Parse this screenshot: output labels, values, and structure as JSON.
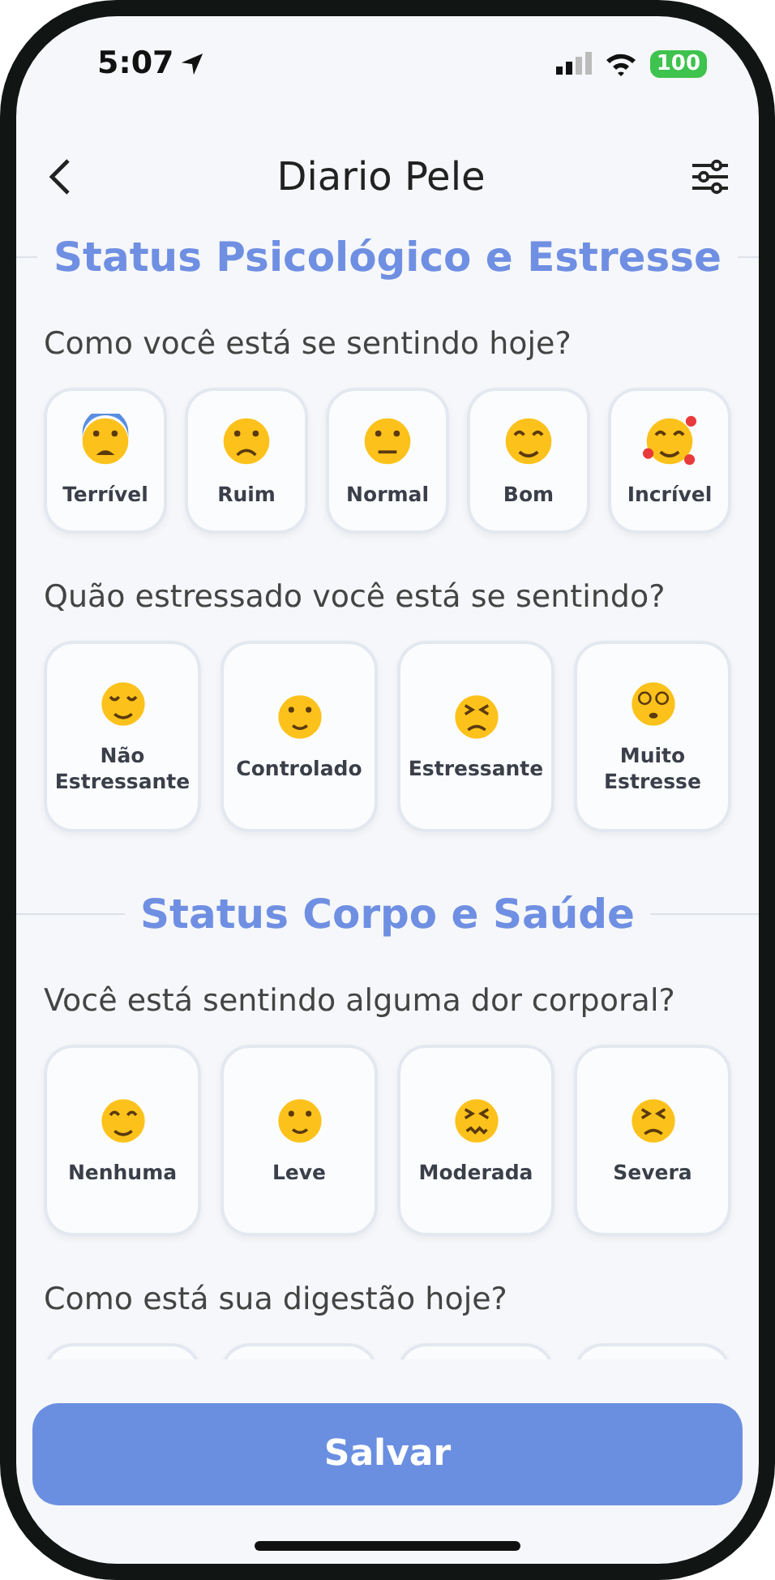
{
  "status_bar": {
    "time": "5:07",
    "battery": "100"
  },
  "header": {
    "title": "Diario Pele"
  },
  "sections": [
    {
      "title": "Status Psicológico e Estresse",
      "questions": [
        {
          "question": "Como você está se sentindo hoje?",
          "options": [
            {
              "label": "Terrível",
              "kind": "anxious",
              "selected": false
            },
            {
              "label": "Ruim",
              "kind": "worried",
              "selected": false
            },
            {
              "label": "Normal",
              "kind": "neutral",
              "selected": false
            },
            {
              "label": "Bom",
              "kind": "smiling",
              "selected": false
            },
            {
              "label": "Incrível",
              "kind": "loving",
              "selected": false
            }
          ]
        },
        {
          "question": "Quão estressado você está se sentindo?",
          "options": [
            {
              "label": "Não Estressante",
              "kind": "relieved",
              "selected": false
            },
            {
              "label": "Controlado",
              "kind": "slight",
              "selected": false
            },
            {
              "label": "Estressante",
              "kind": "persevering",
              "selected": false
            },
            {
              "label": "Muito Estresse",
              "kind": "dizzy",
              "selected": false
            }
          ]
        }
      ]
    },
    {
      "title": "Status Corpo e Saúde",
      "questions": [
        {
          "question": "Você está sentindo alguma dor corporal?",
          "options": [
            {
              "label": "Nenhuma",
              "kind": "smiling",
              "selected": false
            },
            {
              "label": "Leve",
              "kind": "slight",
              "selected": false
            },
            {
              "label": "Moderada",
              "kind": "confounded",
              "selected": false
            },
            {
              "label": "Severa",
              "kind": "persevering",
              "selected": false
            }
          ]
        },
        {
          "question": "Como está sua digestão hoje?",
          "options": [
            {
              "selected": false
            },
            {
              "selected": false
            },
            {
              "selected": false
            },
            {
              "selected": false
            }
          ]
        }
      ]
    }
  ],
  "save_button": "Salvar"
}
